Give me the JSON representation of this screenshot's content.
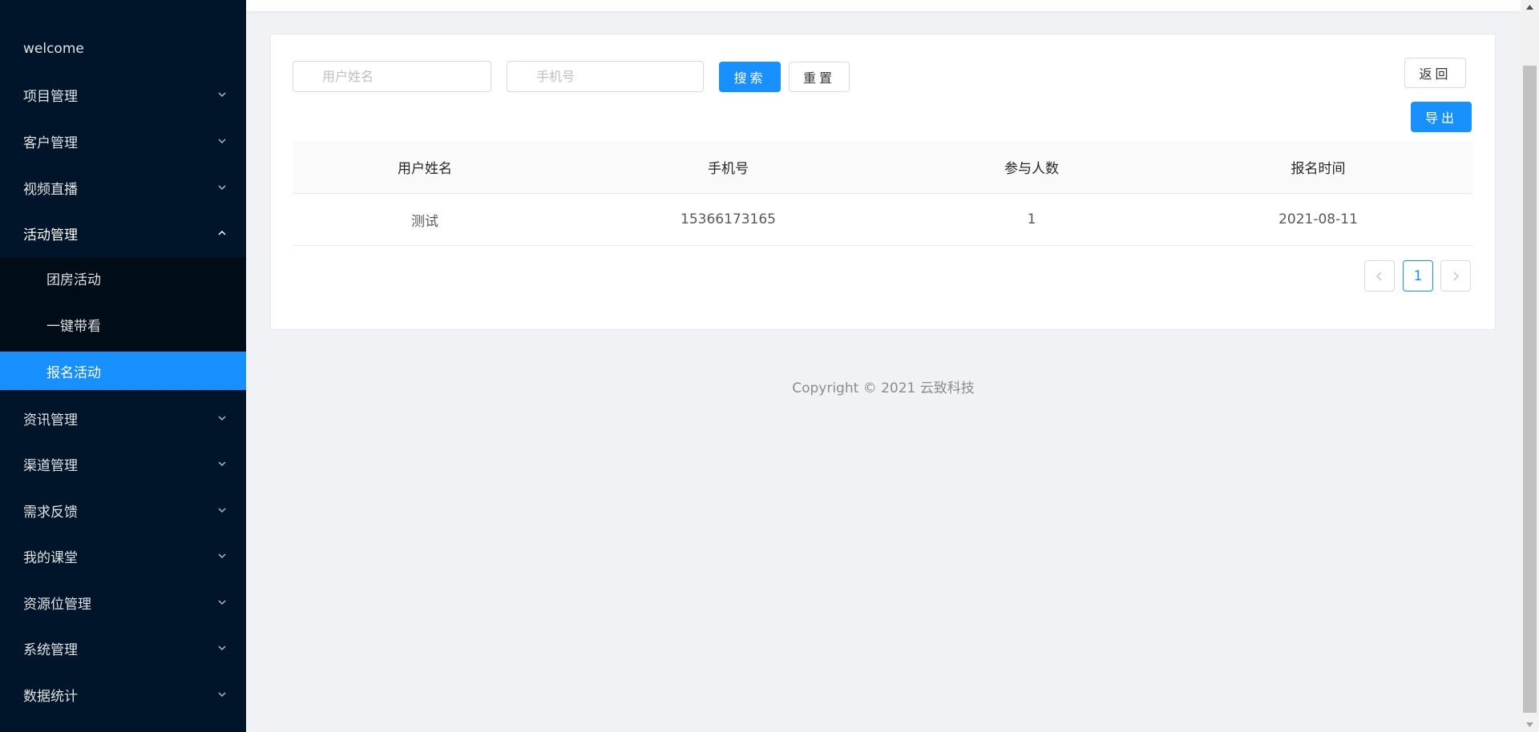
{
  "sidebar": {
    "items": [
      {
        "label": "welcome"
      },
      {
        "label": "项目管理"
      },
      {
        "label": "客户管理"
      },
      {
        "label": "视频直播"
      },
      {
        "label": "活动管理"
      },
      {
        "label": "资讯管理"
      },
      {
        "label": "渠道管理"
      },
      {
        "label": "需求反馈"
      },
      {
        "label": "我的课堂"
      },
      {
        "label": "资源位管理"
      },
      {
        "label": "系统管理"
      },
      {
        "label": "数据统计"
      }
    ],
    "submenu": [
      {
        "label": "团房活动"
      },
      {
        "label": "一键带看"
      },
      {
        "label": "报名活动"
      }
    ]
  },
  "search": {
    "name_placeholder": "用户姓名",
    "phone_placeholder": "手机号",
    "search_label": "搜索",
    "reset_label": "重置",
    "back_label": "返回",
    "export_label": "导出"
  },
  "table": {
    "columns": [
      "用户姓名",
      "手机号",
      "参与人数",
      "报名时间"
    ],
    "rows": [
      [
        "测试",
        "15366173165",
        "1",
        "2021-08-11"
      ]
    ]
  },
  "pagination": {
    "current": "1"
  },
  "footer": {
    "copyright": "Copyright © 2021 云致科技"
  },
  "colors": {
    "sidebar_bg": "#001529",
    "accent": "#1890ff"
  }
}
